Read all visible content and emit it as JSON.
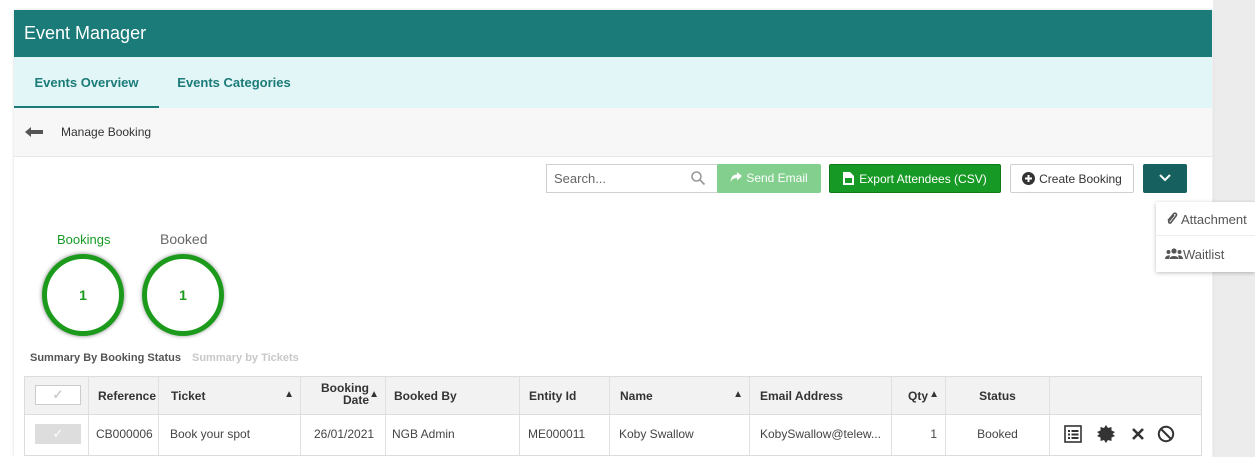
{
  "app": {
    "title": "Event Manager"
  },
  "tabs": [
    {
      "label": "Events Overview",
      "active": true
    },
    {
      "label": "Events Categories",
      "active": false
    }
  ],
  "breadcrumb": {
    "label": "Manage Booking"
  },
  "toolbar": {
    "search_placeholder": "Search...",
    "send_email_label": "Send Email",
    "export_label": "Export Attendees (CSV)",
    "create_booking_label": "Create Booking"
  },
  "dropdown_menu": {
    "items": [
      {
        "label": "Attachment",
        "icon": "paperclip-icon"
      },
      {
        "label": "Waitlist",
        "icon": "users-icon"
      }
    ]
  },
  "stats": {
    "bookings": {
      "label": "Bookings",
      "value": "1"
    },
    "booked": {
      "label": "Booked",
      "value": "1"
    }
  },
  "summary_tabs": {
    "by_status": "Summary By Booking Status",
    "by_tickets": "Summary by Tickets"
  },
  "table": {
    "headers": {
      "reference": "Reference",
      "ticket": "Ticket",
      "booking_date_1": "Booking",
      "booking_date_2": "Date",
      "booked_by": "Booked By",
      "entity_id": "Entity Id",
      "name": "Name",
      "email": "Email Address",
      "qty": "Qty",
      "status": "Status"
    },
    "rows": [
      {
        "reference": "CB000006",
        "ticket": "Book your spot",
        "booking_date": "26/01/2021",
        "booked_by": "NGB Admin",
        "entity_id": "ME000011",
        "name": "Koby Swallow",
        "email": "KobySwallow@telew...",
        "qty": "1",
        "status": "Booked"
      }
    ]
  },
  "colors": {
    "brand": "#1b7b78",
    "tab_bg": "#e3f6f7",
    "export_green": "#179a25",
    "send_green_disabled": "#82cf8e",
    "ring_green": "#1c9a1c"
  }
}
